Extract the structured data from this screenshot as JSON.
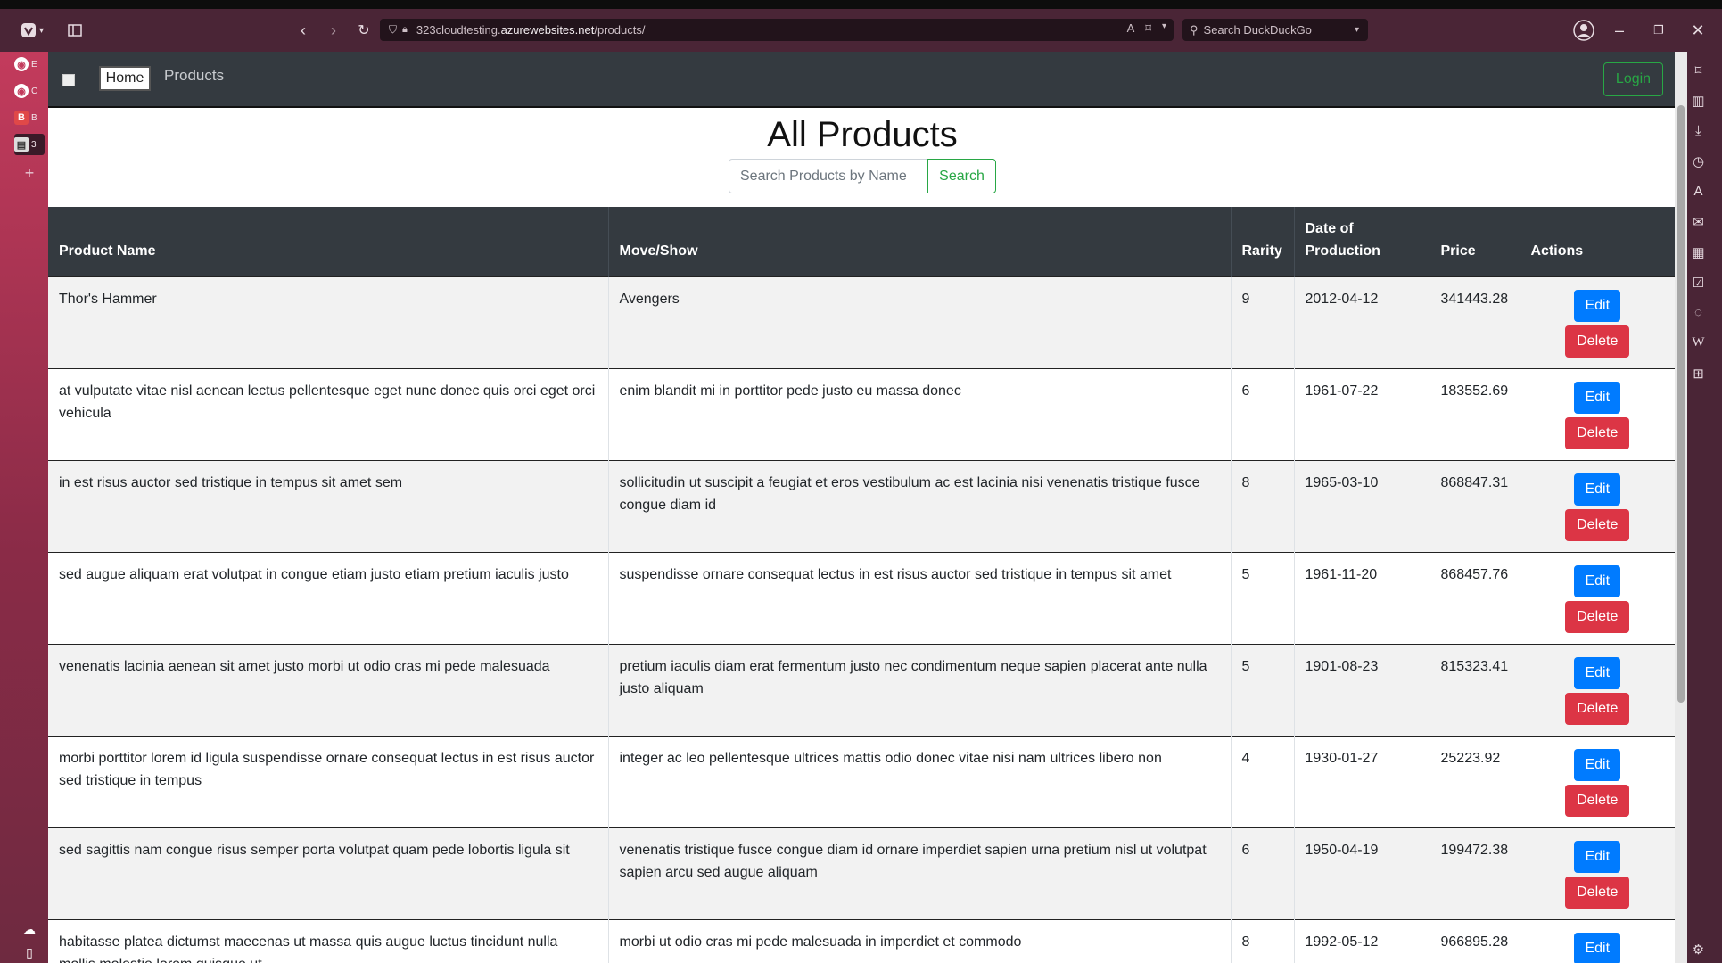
{
  "browser": {
    "url_prefix": "323cloudtesting.",
    "url_domain": "azurewebsites.net",
    "url_path": "/products/",
    "search_placeholder": "Search DuckDuckGo",
    "tabs": [
      {
        "label": "E",
        "icon": "github-icon"
      },
      {
        "label": "C",
        "icon": "github-icon"
      },
      {
        "label": "B",
        "icon": "bootstrap-icon"
      },
      {
        "label": "3",
        "icon": "page-icon"
      }
    ]
  },
  "nav": {
    "home": "Home",
    "products": "Products",
    "login": "Login"
  },
  "page": {
    "title": "All Products",
    "search_placeholder": "Search Products by Name",
    "search_button": "Search"
  },
  "table": {
    "headers": {
      "name": "Product Name",
      "movie": "Move/Show",
      "rarity": "Rarity",
      "date": "Date of Production",
      "price": "Price",
      "actions": "Actions"
    },
    "edit_label": "Edit",
    "delete_label": "Delete",
    "rows": [
      {
        "name": "Thor's Hammer",
        "movie": "Avengers",
        "rarity": "9",
        "date": "2012-04-12",
        "price": "341443.28"
      },
      {
        "name": "at vulputate vitae nisl aenean lectus pellentesque eget nunc donec quis orci eget orci vehicula",
        "movie": "enim blandit mi in porttitor pede justo eu massa donec",
        "rarity": "6",
        "date": "1961-07-22",
        "price": "183552.69"
      },
      {
        "name": "in est risus auctor sed tristique in tempus sit amet sem",
        "movie": "sollicitudin ut suscipit a feugiat et eros vestibulum ac est lacinia nisi venenatis tristique fusce congue diam id",
        "rarity": "8",
        "date": "1965-03-10",
        "price": "868847.31"
      },
      {
        "name": "sed augue aliquam erat volutpat in congue etiam justo etiam pretium iaculis justo",
        "movie": "suspendisse ornare consequat lectus in est risus auctor sed tristique in tempus sit amet",
        "rarity": "5",
        "date": "1961-11-20",
        "price": "868457.76"
      },
      {
        "name": "venenatis lacinia aenean sit amet justo morbi ut odio cras mi pede malesuada",
        "movie": "pretium iaculis diam erat fermentum justo nec condimentum neque sapien placerat ante nulla justo aliquam",
        "rarity": "5",
        "date": "1901-08-23",
        "price": "815323.41"
      },
      {
        "name": "morbi porttitor lorem id ligula suspendisse ornare consequat lectus in est risus auctor sed tristique in tempus",
        "movie": "integer ac leo pellentesque ultrices mattis odio donec vitae nisi nam ultrices libero non",
        "rarity": "4",
        "date": "1930-01-27",
        "price": "25223.92"
      },
      {
        "name": "sed sagittis nam congue risus semper porta volutpat quam pede lobortis ligula sit",
        "movie": "venenatis tristique fusce congue diam id ornare imperdiet sapien urna pretium nisl ut volutpat sapien arcu sed augue aliquam",
        "rarity": "6",
        "date": "1950-04-19",
        "price": "199472.38"
      },
      {
        "name": "habitasse platea dictumst maecenas ut massa quis augue luctus tincidunt nulla mollis molestie lorem quisque ut",
        "movie": "morbi ut odio cras mi pede malesuada in imperdiet et commodo",
        "rarity": "8",
        "date": "1992-05-12",
        "price": "966895.28"
      }
    ]
  },
  "colors": {
    "navbar": "#343a40",
    "edit": "#007bff",
    "delete": "#dc3545",
    "success": "#28a745"
  }
}
